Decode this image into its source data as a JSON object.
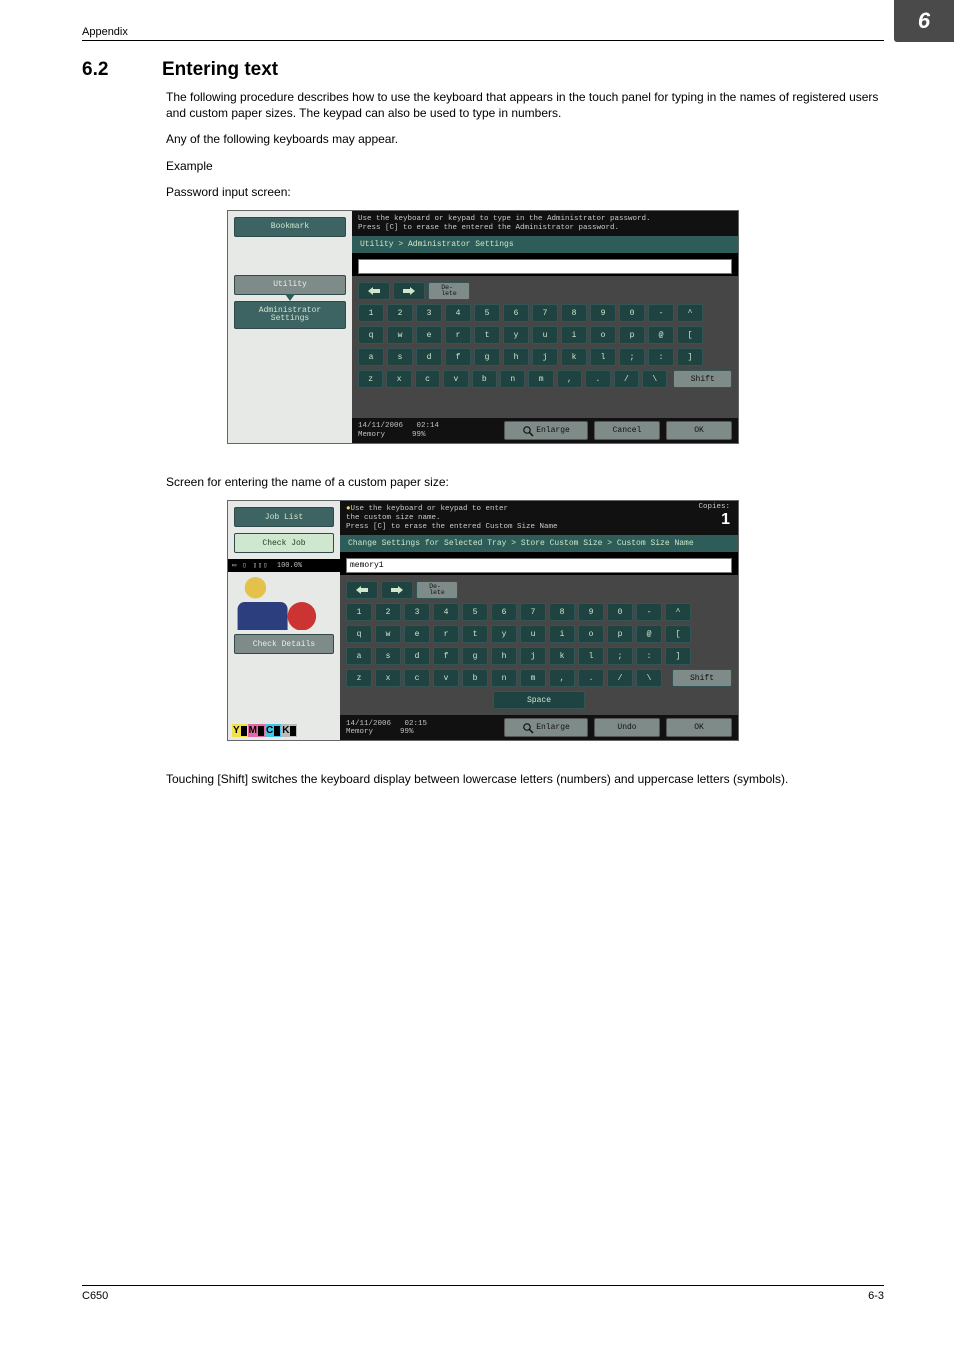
{
  "page": {
    "header": "Appendix",
    "tab_number": "6",
    "section_number": "6.2",
    "section_title": "Entering text",
    "para1": "The following procedure describes how to use the keyboard that appears in the touch panel for typing in the names of registered users and custom paper sizes. The keypad can also be used to type in numbers.",
    "para2": "Any of the following keyboards may appear.",
    "example_label": "Example",
    "caption1": "Password input screen:",
    "caption2": "Screen for entering the name of a custom paper size:",
    "after_shots": "Touching [Shift] switches the keyboard display between lowercase letters (numbers) and uppercase letters (symbols).",
    "footer_left": "C650",
    "footer_right": "6-3"
  },
  "shot1": {
    "hint_line1": "Use the keyboard or keypad to type in the Administrator password.",
    "hint_line2": "Press [C] to erase the entered the Administrator password.",
    "nav": {
      "bookmark": "Bookmark",
      "utility": "Utility",
      "admin": "Administrator\nSettings"
    },
    "breadcrumb": "Utility > Administrator Settings",
    "input_value": "",
    "delete_label": "De-\nlete",
    "row_num": [
      "1",
      "2",
      "3",
      "4",
      "5",
      "6",
      "7",
      "8",
      "9",
      "0",
      "-",
      "^"
    ],
    "row_q": [
      "q",
      "w",
      "e",
      "r",
      "t",
      "y",
      "u",
      "i",
      "o",
      "p",
      "@",
      "["
    ],
    "row_a": [
      "a",
      "s",
      "d",
      "f",
      "g",
      "h",
      "j",
      "k",
      "l",
      ";",
      ":",
      "]"
    ],
    "row_z": [
      "z",
      "x",
      "c",
      "v",
      "b",
      "n",
      "m",
      ",",
      ".",
      "/",
      "\\"
    ],
    "shift_label": "Shift",
    "footer": {
      "date": "14/11/2006",
      "time": "02:14",
      "mem_label": "Memory",
      "mem_val": "99%",
      "enlarge": "Enlarge",
      "cancel": "Cancel",
      "ok": "OK"
    }
  },
  "shot2": {
    "hint_line1": "Use the keyboard or keypad to enter",
    "hint_line2": "the custom size name.",
    "hint_line3": "Press [C] to erase the entered Custom Size Name",
    "copies_label": "Copies:",
    "copies_value": "1",
    "nav": {
      "joblist": "Job List",
      "checkjob": "Check Job",
      "details": "Check Details"
    },
    "status_pct": "100.0%",
    "breadcrumb": "Change Settings for Selected Tray > Store Custom Size > Custom Size Name",
    "input_value": "memory1",
    "delete_label": "De-\nlete",
    "row_num": [
      "1",
      "2",
      "3",
      "4",
      "5",
      "6",
      "7",
      "8",
      "9",
      "0",
      "-",
      "^"
    ],
    "row_q": [
      "q",
      "w",
      "e",
      "r",
      "t",
      "y",
      "u",
      "i",
      "o",
      "p",
      "@",
      "["
    ],
    "row_a": [
      "a",
      "s",
      "d",
      "f",
      "g",
      "h",
      "j",
      "k",
      "l",
      ";",
      ":",
      "]"
    ],
    "row_z": [
      "z",
      "x",
      "c",
      "v",
      "b",
      "n",
      "m",
      ",",
      ".",
      "/",
      "\\"
    ],
    "shift_label": "Shift",
    "space_label": "Space",
    "ymck": {
      "y": "Y",
      "m": "M",
      "c": "C",
      "k": "K"
    },
    "footer": {
      "date": "14/11/2006",
      "time": "02:15",
      "mem_label": "Memory",
      "mem_val": "99%",
      "enlarge": "Enlarge",
      "undo": "Undo",
      "ok": "OK"
    }
  }
}
